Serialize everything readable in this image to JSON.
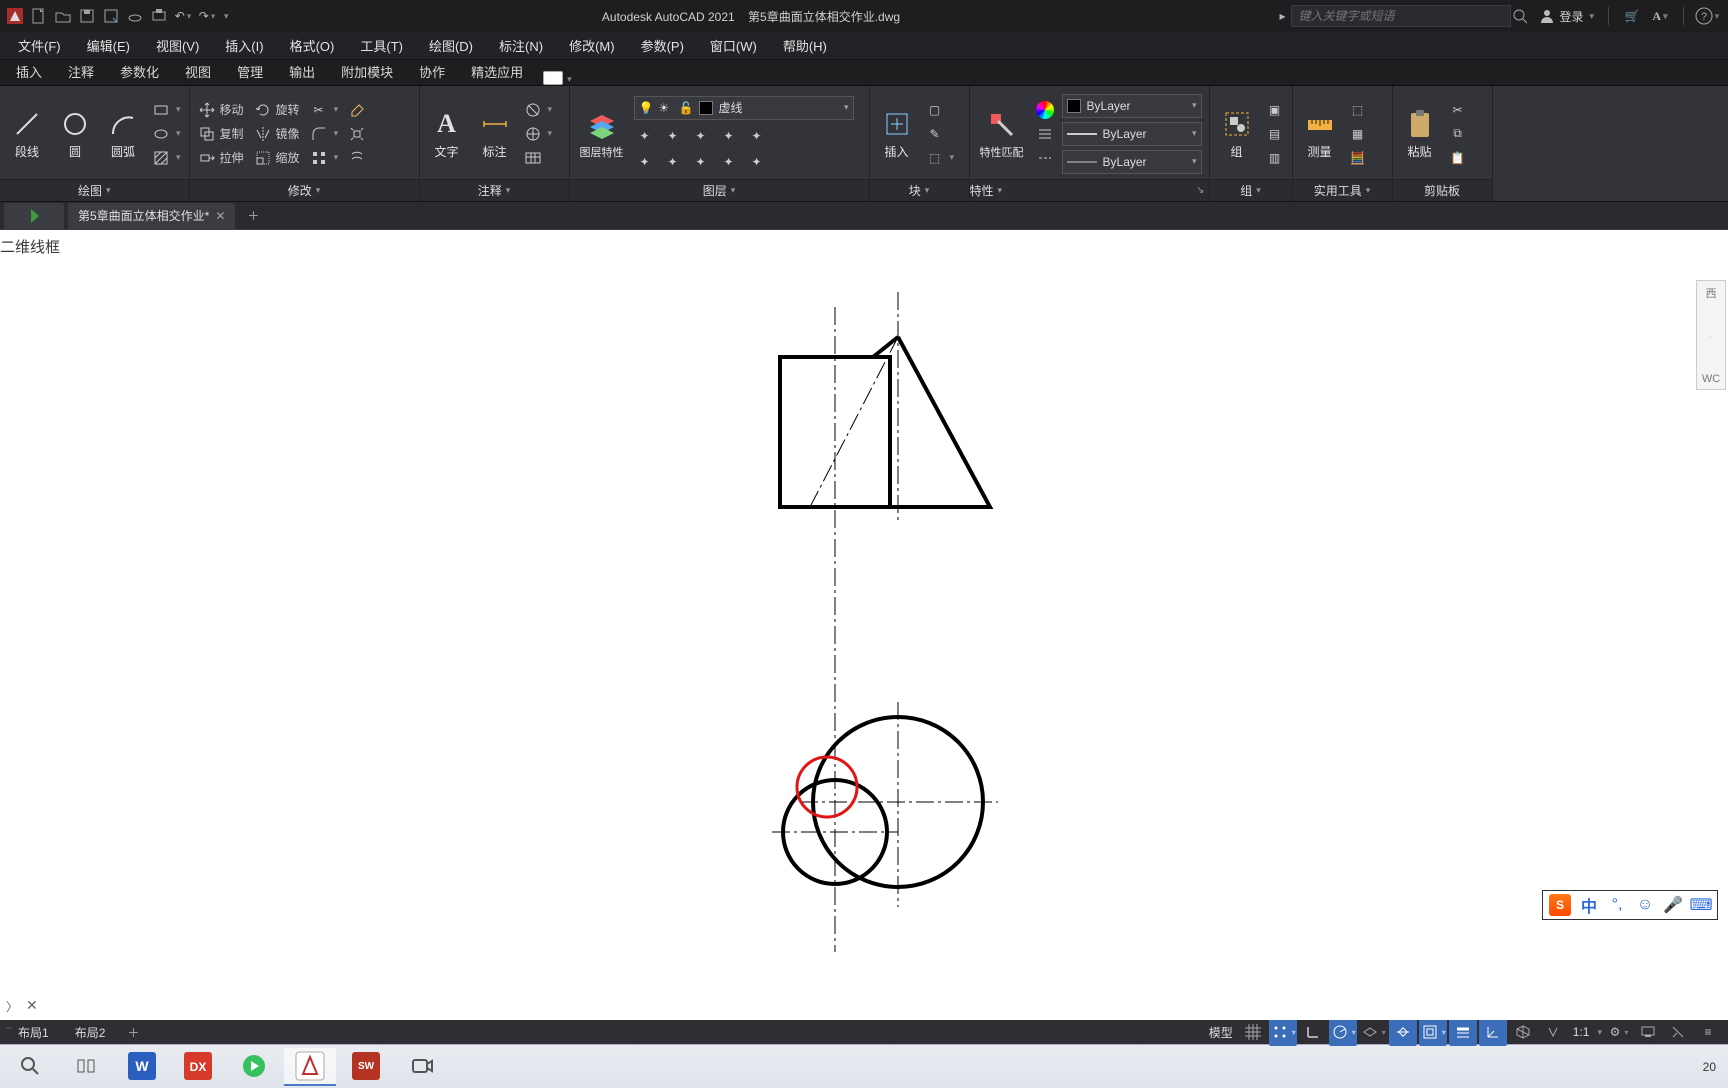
{
  "app": {
    "name": "Autodesk AutoCAD 2021",
    "document": "第5章曲面立体相交作业.dwg",
    "search_placeholder": "键入关键字或短语",
    "signin": "登录"
  },
  "menu": [
    "文件(F)",
    "编辑(E)",
    "视图(V)",
    "插入(I)",
    "格式(O)",
    "工具(T)",
    "绘图(D)",
    "标注(N)",
    "修改(M)",
    "参数(P)",
    "窗口(W)",
    "帮助(H)"
  ],
  "ribbon_tabs": [
    "插入",
    "注释",
    "参数化",
    "视图",
    "管理",
    "输出",
    "附加模块",
    "协作",
    "精选应用"
  ],
  "panels": {
    "draw": {
      "label": "绘图",
      "items": {
        "line": "段线",
        "circle": "圆",
        "arc": "圆弧"
      }
    },
    "modify": {
      "label": "修改",
      "items": {
        "move": "移动",
        "rotate": "旋转",
        "copy": "复制",
        "mirror": "镜像",
        "stretch": "拉伸",
        "scale": "缩放"
      }
    },
    "annotate": {
      "label": "注释",
      "items": {
        "text": "文字",
        "dim": "标注"
      }
    },
    "layers": {
      "label": "图层",
      "big": "图层特性",
      "current": "虚线"
    },
    "block": {
      "label": "块",
      "big": "插入"
    },
    "props": {
      "label": "特性",
      "big": "特性匹配",
      "bylayer": "ByLayer"
    },
    "group": {
      "label": "组",
      "big": "组"
    },
    "util": {
      "label": "实用工具",
      "big": "测量"
    },
    "clip": {
      "label": "剪贴板",
      "big": "粘贴"
    }
  },
  "filetab": {
    "name": "第5章曲面立体相交作业*",
    "start_hint": "开始"
  },
  "viewport_label": "二维线框",
  "side_palette": {
    "top": "西",
    "bottom": "WC"
  },
  "ime": {
    "lang": "中"
  },
  "layout_tabs": [
    "布局1",
    "布局2"
  ],
  "status": {
    "model": "模型",
    "scale": "1:1"
  },
  "taskbar": {
    "time": "20"
  }
}
